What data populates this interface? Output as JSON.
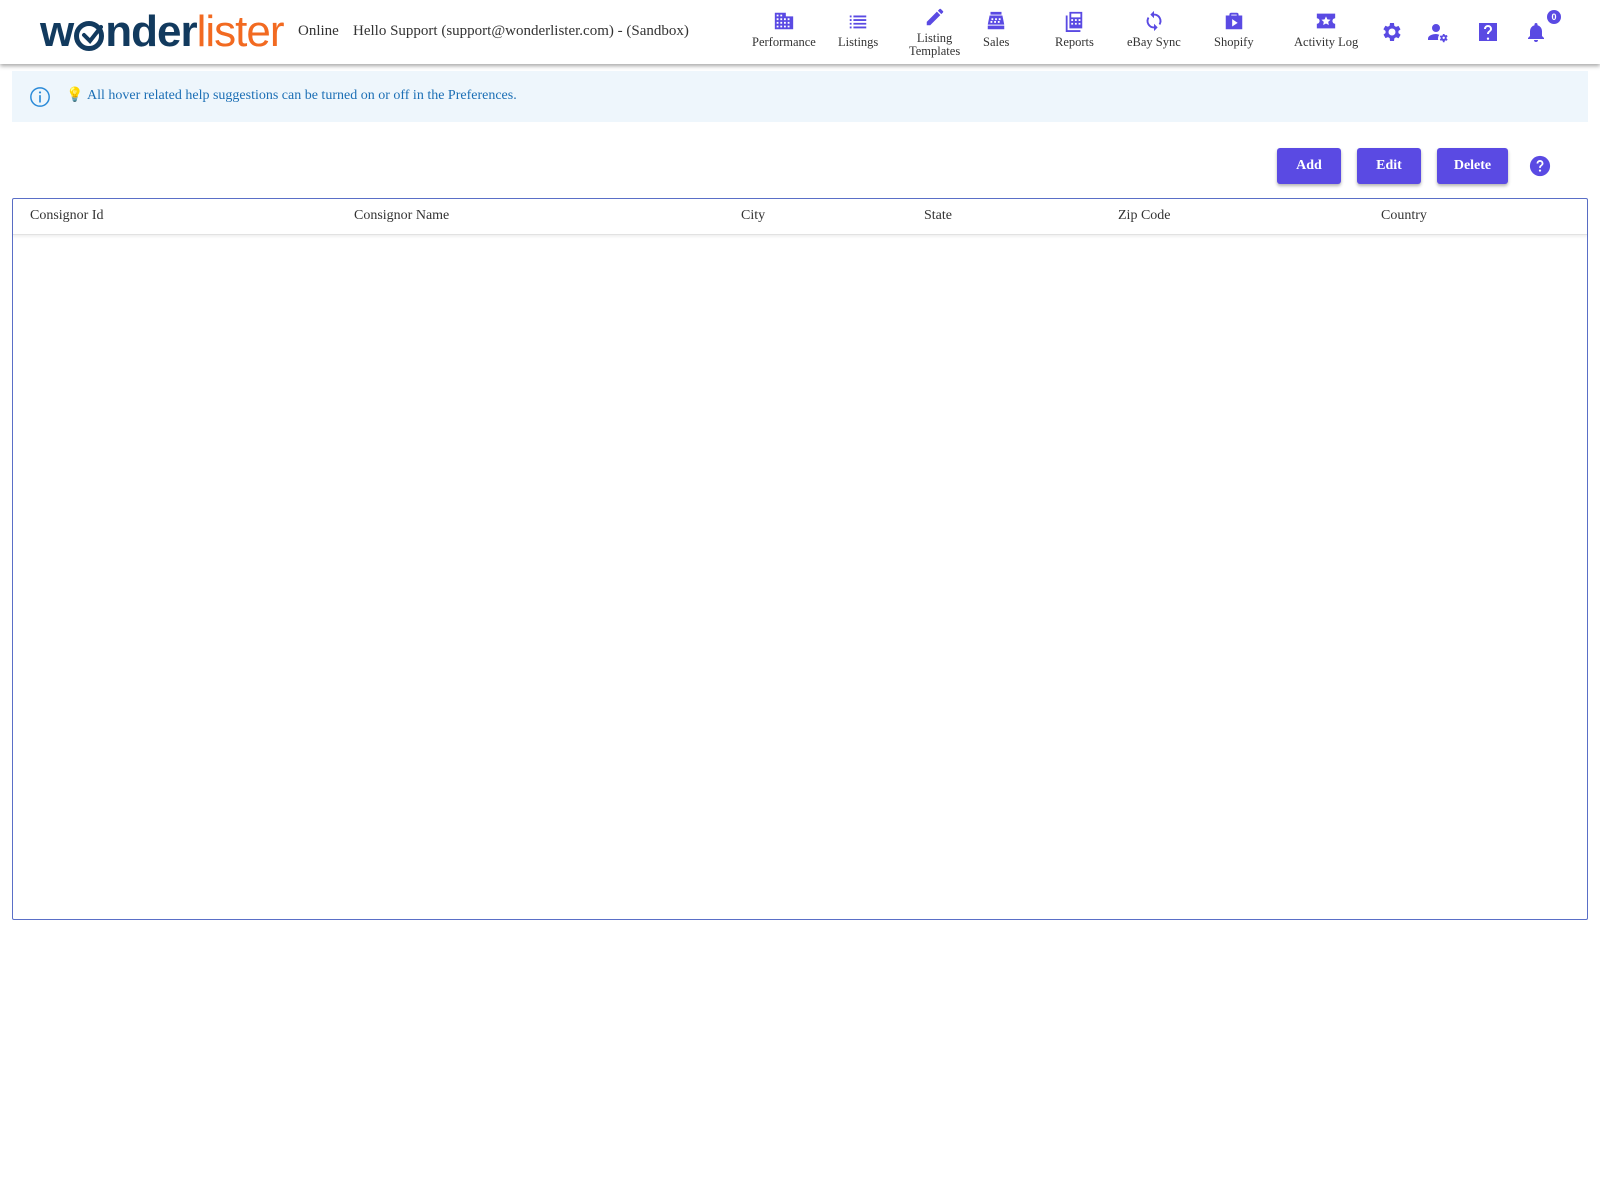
{
  "brand": {
    "logo_prefix": "w",
    "logo_middle": "nder",
    "logo_suffix": "lister"
  },
  "header": {
    "status": "Online",
    "greeting": "Hello Support (support@wonderlister.com) - (Sandbox)",
    "notification_count": "0"
  },
  "nav": [
    {
      "label": "Performance",
      "icon": "building-icon"
    },
    {
      "label": "Listings",
      "icon": "list-icon"
    },
    {
      "label": "Listing",
      "label2": "Templates",
      "icon": "pencil-icon"
    },
    {
      "label": "Sales",
      "icon": "cash-register-icon"
    },
    {
      "label": "Reports",
      "icon": "calculator-icon"
    },
    {
      "label": "eBay Sync",
      "icon": "sync-icon"
    },
    {
      "label": "Shopify",
      "icon": "shopping-bag-icon"
    },
    {
      "label": "Activity Log",
      "icon": "ticket-star-icon"
    }
  ],
  "tools": [
    "gear-icon",
    "user-settings-icon",
    "help-square-icon",
    "bell-icon"
  ],
  "banner": {
    "text": "All hover related help suggestions can be turned on or off in the Preferences."
  },
  "actions": {
    "add": "Add",
    "edit": "Edit",
    "delete": "Delete"
  },
  "table": {
    "columns": [
      "Consignor Id",
      "Consignor Name",
      "City",
      "State",
      "Zip Code",
      "Country"
    ],
    "rows": []
  },
  "colors": {
    "accent": "#5a4ae3",
    "brand_dark": "#123a5e",
    "brand_orange": "#f26a21",
    "banner_bg": "#eef6fc",
    "banner_text": "#1c6fb5"
  }
}
